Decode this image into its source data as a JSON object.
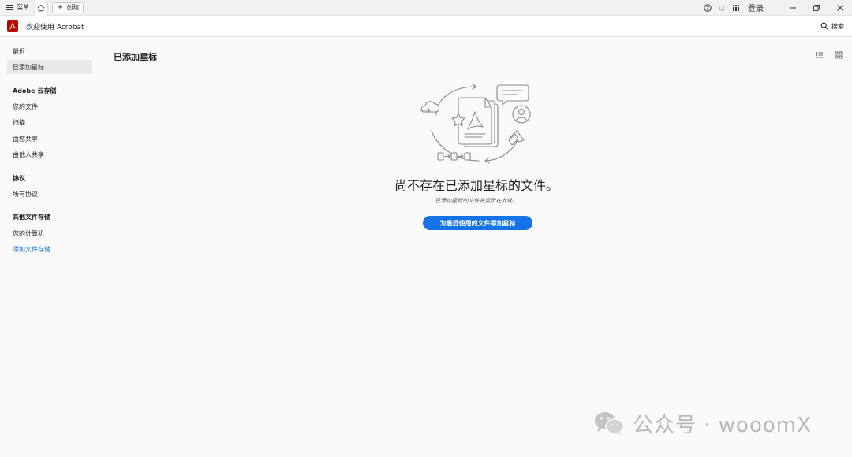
{
  "titlebar": {
    "menu_label": "菜单",
    "create_label": "创建",
    "login_label": "登录"
  },
  "appbar": {
    "title": "欢迎使用 Acrobat",
    "search_label": "搜索"
  },
  "sidebar": {
    "recent": "最近",
    "starred": "已添加星标",
    "adobe_cloud": {
      "heading": "Adobe 云存储",
      "items": [
        "您的文件",
        "扫描",
        "由您共享",
        "由他人共享"
      ]
    },
    "agreements": {
      "heading": "协议",
      "items": [
        "所有协议"
      ]
    },
    "other_storage": {
      "heading": "其他文件存储",
      "items": [
        "您的计算机"
      ],
      "add_link": "添加文件存储"
    }
  },
  "main": {
    "page_title": "已添加星标",
    "empty_title": "尚不存在已添加星标的文件。",
    "empty_subtitle": "已添加星标的文件将显示在此处。",
    "cta_label": "为最近使用的文件添加星标"
  },
  "watermark": {
    "text": "公众号 · wooomX"
  },
  "colors": {
    "accent": "#1473e6",
    "brand_red": "#b30b00",
    "sidebar_active": "#e9e9e9"
  },
  "icons": [
    "menu-icon",
    "home-icon",
    "plus-icon",
    "help-icon",
    "bell-icon",
    "apps-grid-icon",
    "minimize-icon",
    "restore-icon",
    "close-icon",
    "acrobat-logo-icon",
    "search-icon",
    "list-view-icon",
    "grid-view-icon",
    "wechat-icon"
  ]
}
